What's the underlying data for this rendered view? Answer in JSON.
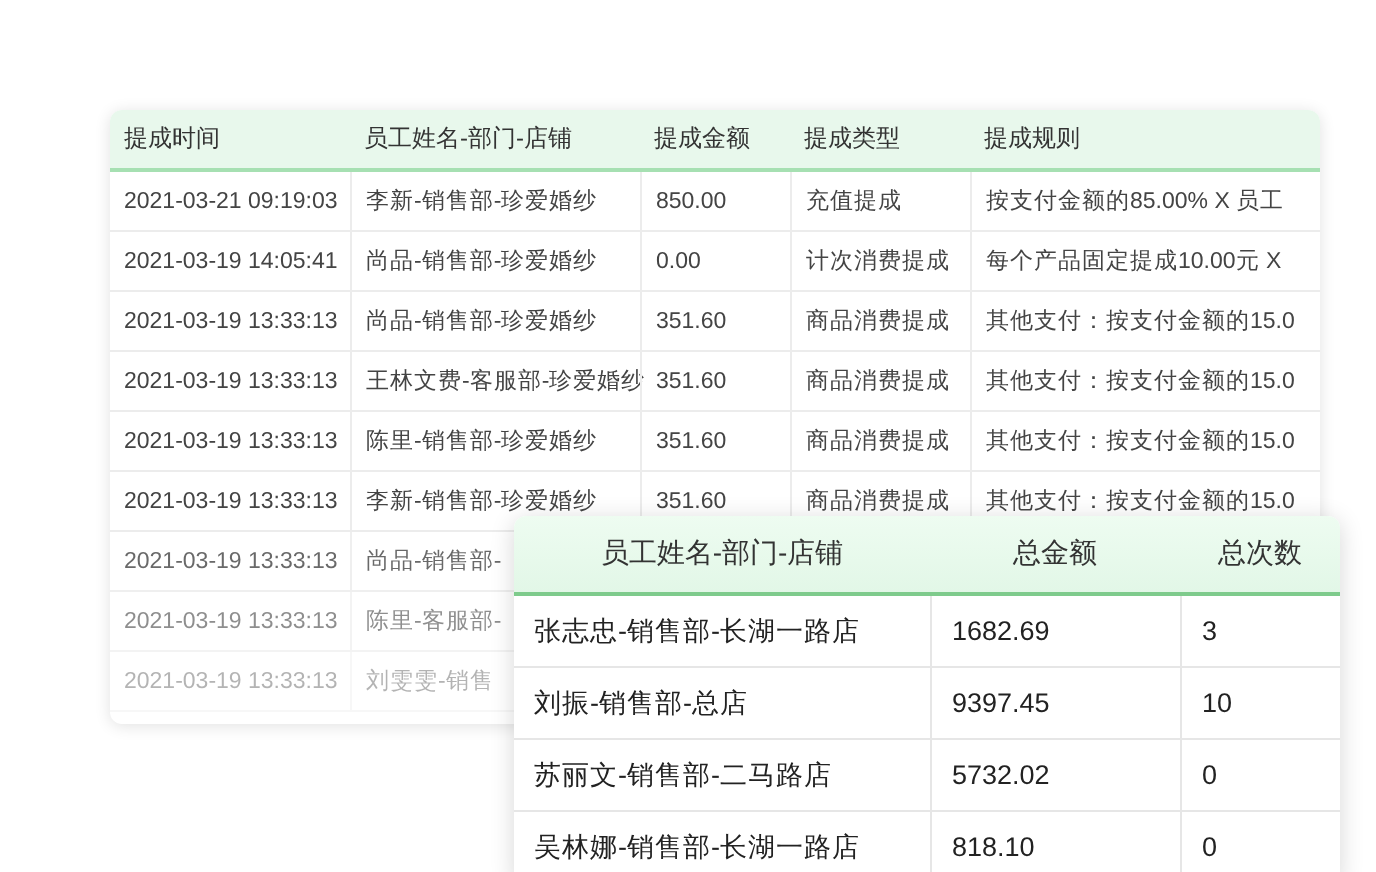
{
  "commission_table": {
    "columns": [
      "提成时间",
      "员工姓名-部门-店铺",
      "提成金额",
      "提成类型",
      "提成规则"
    ],
    "rows": [
      {
        "cells": [
          "2021-03-21 09:19:03",
          "李新-销售部-珍爱婚纱",
          "850.00",
          "充值提成",
          "按支付金额的85.00% X 员工"
        ]
      },
      {
        "cells": [
          "2021-03-19 14:05:41",
          "尚品-销售部-珍爱婚纱",
          "0.00",
          "计次消费提成",
          "每个产品固定提成10.00元 X"
        ]
      },
      {
        "cells": [
          "2021-03-19 13:33:13",
          "尚品-销售部-珍爱婚纱",
          "351.60",
          "商品消费提成",
          "其他支付：按支付金额的15.0"
        ]
      },
      {
        "cells": [
          "2021-03-19 13:33:13",
          "王林文费-客服部-珍爱婚纱",
          "351.60",
          "商品消费提成",
          "其他支付：按支付金额的15.0"
        ]
      },
      {
        "cells": [
          "2021-03-19 13:33:13",
          "陈里-销售部-珍爱婚纱",
          "351.60",
          "商品消费提成",
          "其他支付：按支付金额的15.0"
        ]
      },
      {
        "cells": [
          "2021-03-19 13:33:13",
          "李新-销售部-珍爱婚纱",
          "351.60",
          "商品消费提成",
          "其他支付：按支付金额的15.0"
        ]
      },
      {
        "cells": [
          "2021-03-19 13:33:13",
          "尚品-销售部-"
        ]
      },
      {
        "cells": [
          "2021-03-19 13:33:13",
          "陈里-客服部-"
        ]
      },
      {
        "cells": [
          "2021-03-19 13:33:13",
          "刘雯雯-销售"
        ]
      }
    ]
  },
  "summary_table": {
    "columns": [
      "员工姓名-部门-店铺",
      "总金额",
      "总次数"
    ],
    "rows": [
      {
        "cells": [
          "张志忠-销售部-长湖一路店",
          "1682.69",
          "3"
        ]
      },
      {
        "cells": [
          "刘振-销售部-总店",
          "9397.45",
          "10"
        ]
      },
      {
        "cells": [
          "苏丽文-销售部-二马路店",
          "5732.02",
          "0"
        ]
      },
      {
        "cells": [
          "吴林娜-销售部-长湖一路店",
          "818.10",
          "0"
        ]
      }
    ]
  }
}
